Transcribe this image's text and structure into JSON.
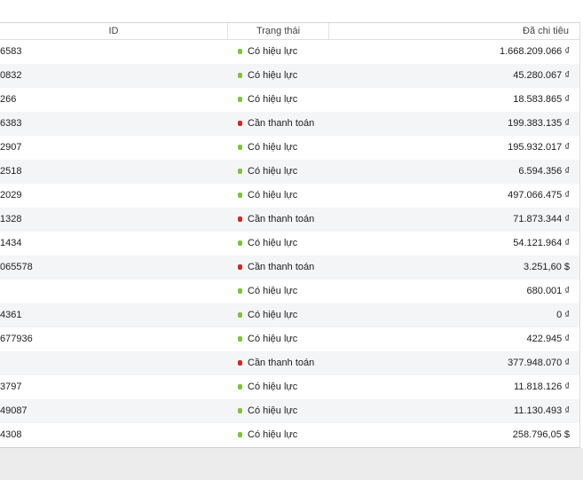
{
  "table": {
    "columns": {
      "id": "ID",
      "status": "Trạng thái",
      "spent": "Đã chi tiêu"
    },
    "colors": {
      "active": "#7ec13c",
      "payment_due": "#d0281d"
    },
    "rows": [
      {
        "id": "6583",
        "status": "Có hiệu lực",
        "status_type": "active",
        "spent": "1.668.209.066 ₫"
      },
      {
        "id": "0832",
        "status": "Có hiệu lực",
        "status_type": "active",
        "spent": "45.280.067 ₫"
      },
      {
        "id": "266",
        "status": "Có hiệu lực",
        "status_type": "active",
        "spent": "18.583.865 ₫"
      },
      {
        "id": "6383",
        "status": "Cần thanh toán",
        "status_type": "payment_due",
        "spent": "199.383.135 ₫"
      },
      {
        "id": "2907",
        "status": "Có hiệu lực",
        "status_type": "active",
        "spent": "195.932.017 ₫"
      },
      {
        "id": "2518",
        "status": "Có hiệu lực",
        "status_type": "active",
        "spent": "6.594.356 ₫"
      },
      {
        "id": "2029",
        "status": "Có hiệu lực",
        "status_type": "active",
        "spent": "497.066.475 ₫"
      },
      {
        "id": "1328",
        "status": "Cần thanh toán",
        "status_type": "payment_due",
        "spent": "71.873.344 ₫"
      },
      {
        "id": "1434",
        "status": "Có hiệu lực",
        "status_type": "active",
        "spent": "54.121.964 ₫"
      },
      {
        "id": "065578",
        "status": "Cần thanh toán",
        "status_type": "payment_due",
        "spent": "3.251,60 $"
      },
      {
        "id": "",
        "status": "Có hiệu lực",
        "status_type": "active",
        "spent": "680.001 ₫"
      },
      {
        "id": "4361",
        "status": "Có hiệu lực",
        "status_type": "active",
        "spent": "0 ₫"
      },
      {
        "id": "677936",
        "status": "Có hiệu lực",
        "status_type": "active",
        "spent": "422.945 ₫"
      },
      {
        "id": "",
        "status": "Cần thanh toán",
        "status_type": "payment_due",
        "spent": "377.948.070 ₫"
      },
      {
        "id": "3797",
        "status": "Có hiệu lực",
        "status_type": "active",
        "spent": "11.818.126 ₫"
      },
      {
        "id": "49087",
        "status": "Có hiệu lực",
        "status_type": "active",
        "spent": "11.130.493 ₫"
      },
      {
        "id": "4308",
        "status": "Có hiệu lực",
        "status_type": "active",
        "spent": "258.796,05 $"
      }
    ]
  }
}
